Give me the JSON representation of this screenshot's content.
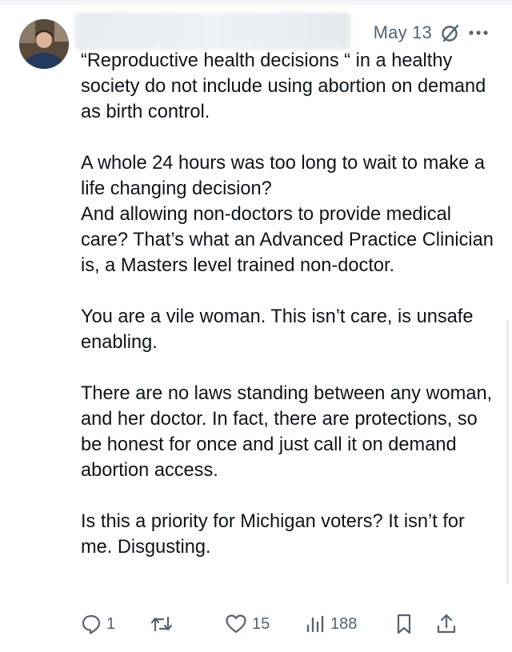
{
  "tweet": {
    "date": "May 13",
    "paragraphs": [
      "“Reproductive health decisions “ in a healthy society do not include using abortion on demand as birth control.",
      "A whole 24 hours was too long to wait to make a life changing decision?\nAnd allowing non-doctors to provide medical care?  That’s what an Advanced Practice Clinician is, a Masters level trained non-doctor.",
      "You are a vile woman.  This isn’t care, is unsafe enabling.",
      "There are no laws standing between any woman, and her doctor.  In fact, there are protections, so be honest for once and just call it on demand abortion access.",
      "Is this a priority for Michigan voters?  It isn’t for me.  Disgusting."
    ]
  },
  "actions": {
    "reply_count": "1",
    "retweet_count": "",
    "like_count": "15",
    "view_count": "188"
  },
  "icons": {
    "meta": [
      "grok-slash-icon",
      "more-options-icon"
    ],
    "actions": [
      "reply-icon",
      "retweet-icon",
      "like-icon",
      "views-icon",
      "bookmark-icon",
      "share-icon"
    ]
  },
  "colors": {
    "text": "#0f1419",
    "muted": "#536471"
  }
}
